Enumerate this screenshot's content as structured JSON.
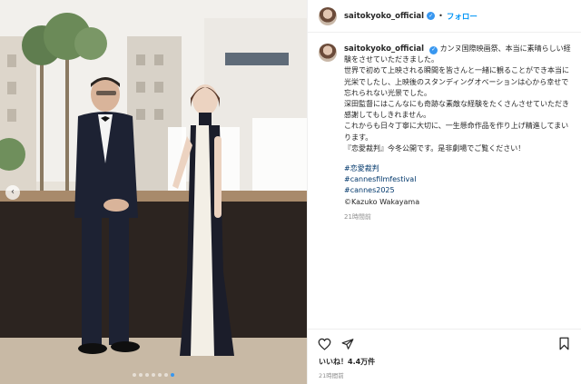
{
  "post": {
    "username": "saitokyoko_official",
    "follow_label": "フォロー",
    "separator": "•",
    "caption_first": "カンヌ国際映画祭、本当に素晴らしい経験をさせていただきました。",
    "caption_lines": [
      "世界で初めて上映される瞬間を皆さんと一緒に観ることができ本当に光栄でしたし、上映後のスタンディングオベーションは心から幸せで忘れられない光景でした。",
      "深田監督にはこんなにも奇跡な素敵な経験をたくさんさせていただき感謝してもしきれません。",
      "これからも日々丁寧に大切に、一生懸命作品を作り上げ精進してまいります。",
      "『恋愛裁判』今冬公開です。是非劇場でご覧ください！"
    ],
    "hashtags": [
      "#恋愛裁判",
      "#cannesfilmfestival",
      "#cannes2025"
    ],
    "credit": "©Kazuko Wakayama",
    "caption_time": "21時間前",
    "likes_label": "いいね！4.4万件",
    "time_label": "21時間前",
    "carousel_dots": 7,
    "carousel_active_index": 6,
    "accent_color": "#0095f6"
  },
  "icons": {
    "heart": "heart-icon",
    "share": "send-icon",
    "save": "bookmark-icon",
    "verified": "verified-badge-icon",
    "prev": "chevron-left-icon"
  }
}
